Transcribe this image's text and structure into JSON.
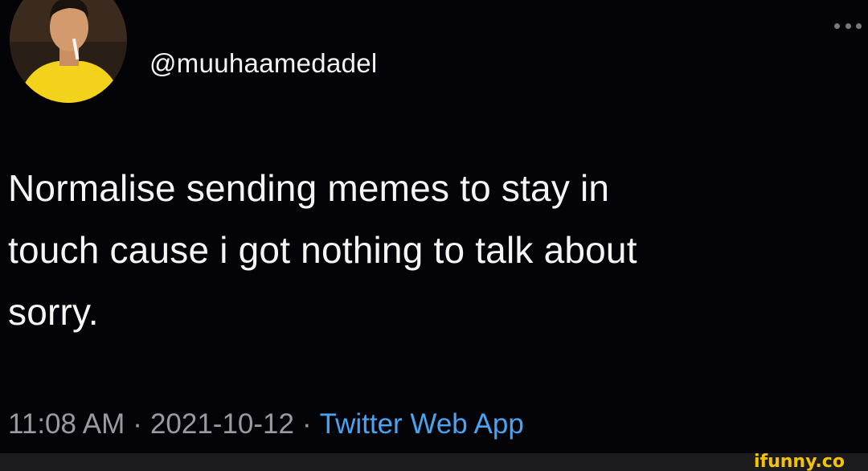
{
  "tweet": {
    "username": "@muuhaamedadel",
    "text_lines": [
      "Normalise sending memes to stay in",
      "touch cause i got nothing to talk about",
      "sorry."
    ],
    "time": "11:08 AM",
    "separator": "·",
    "date": "2021-10-12",
    "source": "Twitter Web App"
  },
  "icons": {
    "more": "more-options-icon",
    "avatar": "profile-avatar"
  },
  "watermark": {
    "text": "ifunny.co"
  },
  "colors": {
    "background": "#040408",
    "text": "#f5f5f5",
    "meta": "#9a9aa0",
    "source_link": "#4aa3f0",
    "watermark": "#f5c400"
  }
}
